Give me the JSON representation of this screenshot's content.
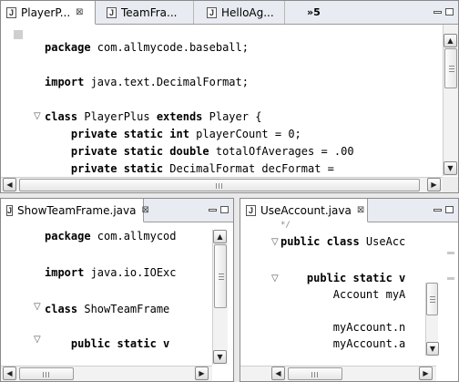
{
  "top_editor": {
    "tabs": [
      {
        "label": "PlayerP...",
        "close": "⊠",
        "icon": "java-file-icon"
      },
      {
        "label": "TeamFra...",
        "icon": "java-file-icon"
      },
      {
        "label": "HelloAg...",
        "icon": "java-file-icon"
      },
      {
        "label": "»5",
        "icon": "overflow-chevron-icon"
      }
    ],
    "lines": [
      {
        "kw": "package",
        "rest": " com.allmycode.baseball;"
      },
      {
        "kw": "",
        "rest": ""
      },
      {
        "kw": "import",
        "rest": " java.text.DecimalFormat;"
      },
      {
        "kw": "",
        "rest": ""
      },
      {
        "kw": "class",
        "rest": " PlayerPlus ",
        "kw2": "extends",
        "rest2": " Player {",
        "fold": "▽"
      },
      {
        "kw": "    private static int",
        "rest": " playerCount = 0;"
      },
      {
        "kw": "    private static double",
        "rest": " totalOfAverages = .00"
      },
      {
        "kw": "    private static",
        "rest": " DecimalFormat decFormat ="
      }
    ]
  },
  "left_editor": {
    "tab": {
      "label": "ShowTeamFrame.java",
      "close": "⊠",
      "icon": "java-file-icon"
    },
    "lines": [
      {
        "kw": "package",
        "rest": " com.allmycod"
      },
      {
        "kw": "",
        "rest": ""
      },
      {
        "kw": "import",
        "rest": " java.io.IOExc"
      },
      {
        "kw": "",
        "rest": ""
      },
      {
        "kw": "class",
        "rest": " ShowTeamFrame",
        "fold": "▽"
      },
      {
        "kw": "",
        "rest": ""
      },
      {
        "kw": "    public static v",
        "rest": "",
        "fold": "▽"
      }
    ]
  },
  "right_editor": {
    "tab": {
      "label": "UseAccount.java",
      "close": "⊠",
      "icon": "java-file-icon"
    },
    "lines": [
      {
        "kw": "",
        "rest": "*/"
      },
      {
        "kw": "public class",
        "rest": " UseAcc",
        "fold": "▽"
      },
      {
        "kw": "",
        "rest": ""
      },
      {
        "kw": "",
        "rest": ""
      },
      {
        "kw": "    public static v",
        "rest": "",
        "fold": "▽"
      },
      {
        "kw": "",
        "rest": "        Account myA"
      },
      {
        "kw": "",
        "rest": ""
      },
      {
        "kw": "",
        "rest": "        myAccount.n"
      },
      {
        "kw": "",
        "rest": "        myAccount.a"
      }
    ]
  },
  "scroll": {
    "up": "▲",
    "down": "▼",
    "left": "◀",
    "right": "▶",
    "hgrip": "III"
  }
}
